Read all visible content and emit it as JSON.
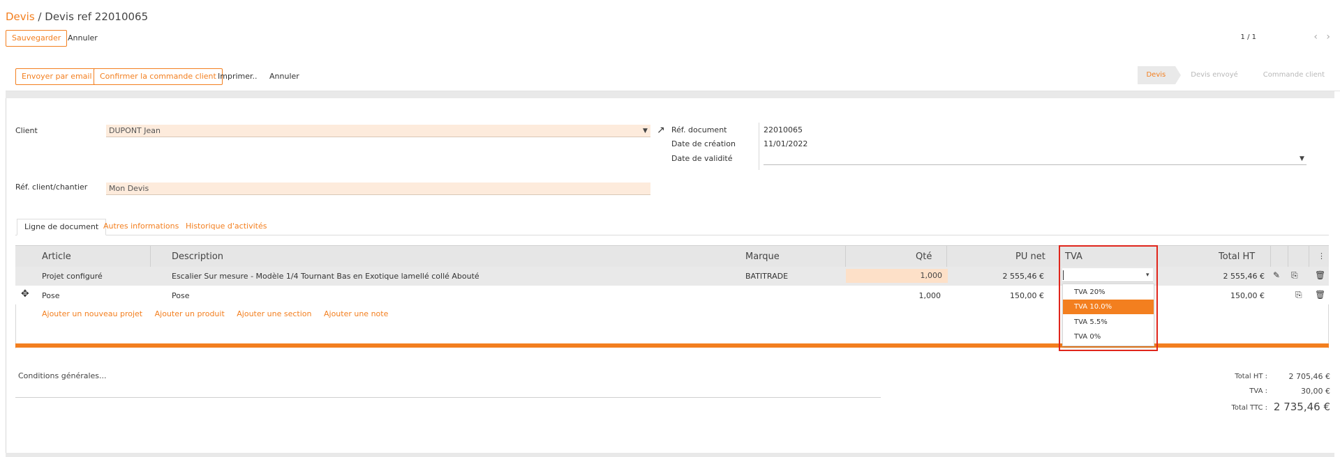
{
  "header": {
    "breadcrumb_link": "Devis",
    "breadcrumb_sep": "/",
    "breadcrumb_current": "Devis ref 22010065",
    "save_label": "Sauvegarder",
    "cancel_label": "Annuler",
    "pager": "1 / 1"
  },
  "actions": {
    "email_label": "Envoyer par email",
    "confirm_label": "Confirmer la commande client",
    "print_label": "Imprimer..",
    "cancel_label": "Annuler"
  },
  "status_steps": [
    {
      "label": "Devis",
      "active": true
    },
    {
      "label": "Devis envoyé",
      "active": false
    },
    {
      "label": "Commande client",
      "active": false
    }
  ],
  "form": {
    "client_label": "Client",
    "client_value": "DUPONT Jean",
    "ref_client_label": "Réf. client/chantier",
    "ref_client_value": "Mon Devis",
    "ref_doc_label": "Réf. document",
    "ref_doc_value": "22010065",
    "date_creation_label": "Date de création",
    "date_creation_value": "11/01/2022",
    "date_validite_label": "Date de validité",
    "date_validite_value": ""
  },
  "tabs": [
    {
      "label": "Ligne de document",
      "active": true
    },
    {
      "label": "Autres informations",
      "active": false
    },
    {
      "label": "Historique d'activités",
      "active": false
    }
  ],
  "table": {
    "columns": {
      "article": "Article",
      "description": "Description",
      "marque": "Marque",
      "qte": "Qté",
      "pu_net": "PU net",
      "tva": "TVA",
      "total_ht": "Total HT"
    },
    "rows": [
      {
        "article": "Projet configuré",
        "description": "Escalier Sur mesure - Modèle 1/4 Tournant Bas en Exotique lamellé collé Abouté",
        "marque": "BATITRADE",
        "qte": "1,000",
        "pu_net": "2 555,46 €",
        "tva": "",
        "total_ht": "2 555,46 €"
      },
      {
        "article": "Pose",
        "description": "Pose",
        "marque": "",
        "qte": "1,000",
        "pu_net": "150,00 €",
        "tva": "",
        "total_ht": "150,00 €"
      }
    ],
    "add_links": [
      "Ajouter un nouveau projet",
      "Ajouter un produit",
      "Ajouter une section",
      "Ajouter une note"
    ]
  },
  "tva_dropdown": {
    "options": [
      "TVA 20%",
      "TVA 10.0%",
      "TVA 5.5%",
      "TVA 0%"
    ],
    "selected": "TVA 10.0%"
  },
  "footer": {
    "conditions_label": "Conditions générales...",
    "total_ht_label": "Total HT :",
    "total_ht_value": "2 705,46 €",
    "tva_label": "TVA :",
    "tva_value": "30,00 €",
    "total_ttc_label": "Total TTC :",
    "total_ttc_value": "2 735,46 €"
  },
  "colors": {
    "accent": "#f37f1f",
    "highlight_border": "#e0251b",
    "field_bg": "#fdebdc"
  }
}
